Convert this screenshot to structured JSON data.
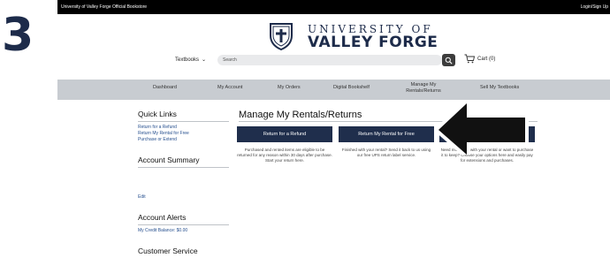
{
  "step_number": "3",
  "topbar": {
    "store_name": "University of Valley Forge Official Bookstore",
    "login": "Login/Sign Up"
  },
  "logo": {
    "line1": "UNIVERSITY OF",
    "line2": "VALLEY FORGE"
  },
  "header": {
    "textbooks": "Textbooks",
    "search_placeholder": "Search",
    "cart": "Cart (0)"
  },
  "nav": {
    "items": [
      "Dashboard",
      "My Account",
      "My Orders",
      "Digital Bookshelf",
      "Manage My Rentals/Returns",
      "Sell My Textbooks"
    ]
  },
  "sidebar": {
    "quick_links_title": "Quick Links",
    "quick_links": [
      "Return for a Refund",
      "Return My Rental for Free",
      "Purchase or Extend"
    ],
    "account_summary_title": "Account Summary",
    "edit": "Edit",
    "account_alerts_title": "Account Alerts",
    "credit_balance": "My Credit Balance: $0.00",
    "customer_service_title": "Customer Service"
  },
  "main": {
    "title": "Manage My Rentals/Returns",
    "buttons": [
      "Return for a Refund",
      "Return My Rental for Free",
      "nd"
    ],
    "descriptions": [
      "Purchased and rented items are eligible to be returned for any reason within 30 days after purchase. Start your return here.",
      "Finished with your rental? Send it back to us using our free UPS return label service.",
      "Need more time with your rental or want to purchase it to keep? Choose your options here and easily pay for extensions and purchases."
    ]
  },
  "colors": {
    "brand_navy": "#1f2e4c",
    "nav_gray": "#c8ccd1",
    "link_blue": "#27508f",
    "topbar": "#000000"
  }
}
